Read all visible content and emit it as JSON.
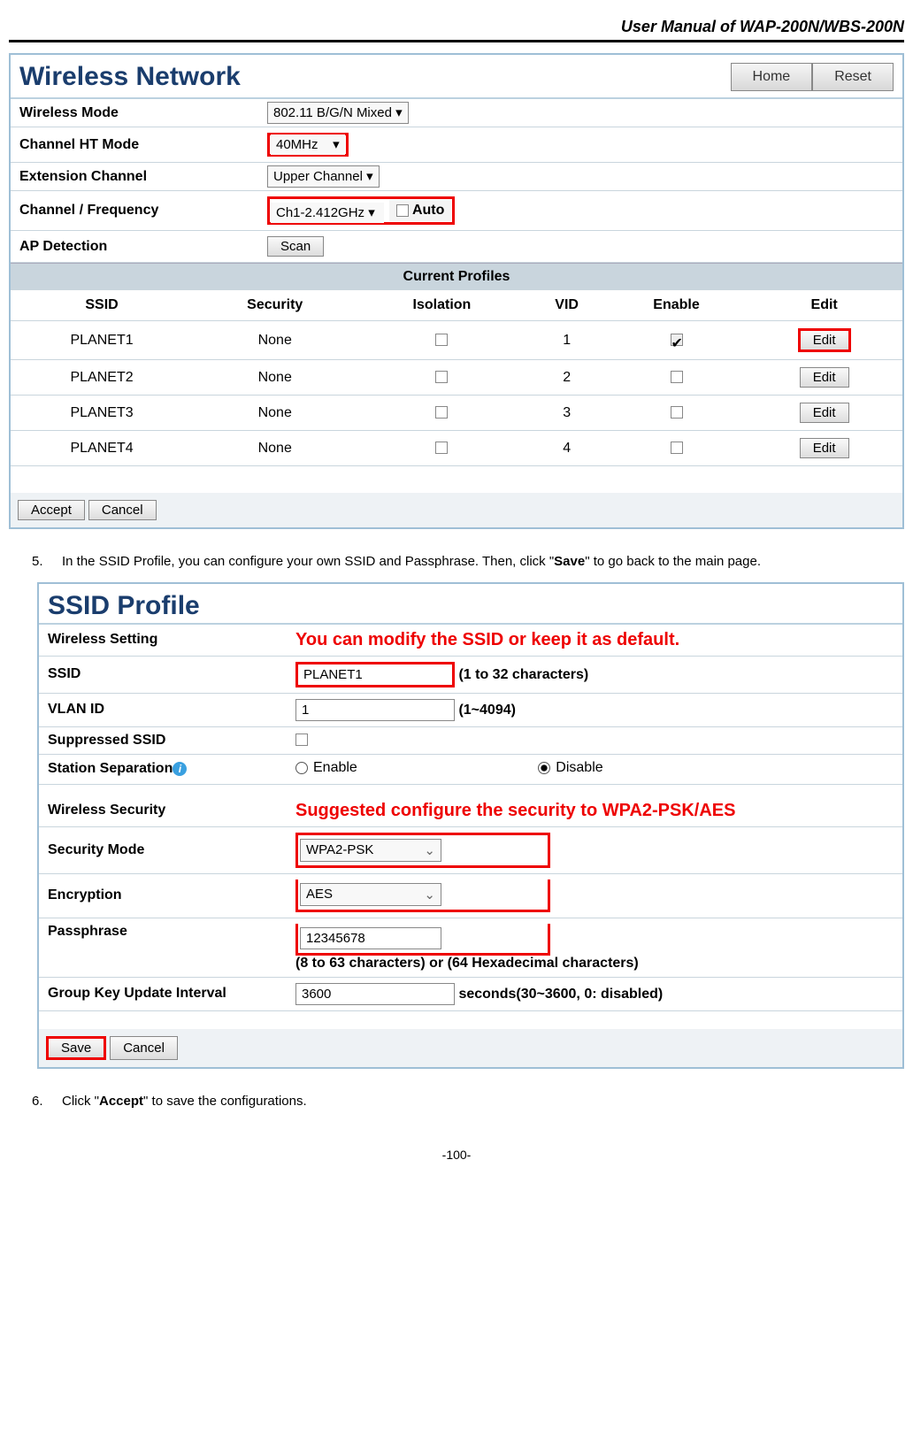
{
  "header": {
    "title": "User Manual of WAP-200N/WBS-200N"
  },
  "wireless": {
    "title": "Wireless Network",
    "homeBtn": "Home",
    "resetBtn": "Reset",
    "rows": {
      "wirelessMode": {
        "label": "Wireless Mode",
        "value": "802.11 B/G/N Mixed"
      },
      "channelHT": {
        "label": "Channel HT Mode",
        "value": "40MHz"
      },
      "extChannel": {
        "label": "Extension Channel",
        "value": "Upper Channel"
      },
      "channelFreq": {
        "label": "Channel / Frequency",
        "value": "Ch1-2.412GHz",
        "autoLabel": "Auto"
      },
      "apDetection": {
        "label": "AP Detection",
        "scanBtn": "Scan"
      }
    },
    "profilesTitle": "Current Profiles",
    "profilesCols": {
      "ssid": "SSID",
      "security": "Security",
      "isolation": "Isolation",
      "vid": "VID",
      "enable": "Enable",
      "edit": "Edit"
    },
    "profiles": [
      {
        "ssid": "PLANET1",
        "security": "None",
        "vid": "1",
        "enabled": true
      },
      {
        "ssid": "PLANET2",
        "security": "None",
        "vid": "2",
        "enabled": false
      },
      {
        "ssid": "PLANET3",
        "security": "None",
        "vid": "3",
        "enabled": false
      },
      {
        "ssid": "PLANET4",
        "security": "None",
        "vid": "4",
        "enabled": false
      }
    ],
    "editBtn": "Edit",
    "acceptBtn": "Accept",
    "cancelBtn": "Cancel"
  },
  "step5": {
    "num": "5.",
    "textA": "In the SSID Profile, you can configure your own SSID and Passphrase. Then, click \"",
    "bold": "Save",
    "textB": "\" to go back to the main page."
  },
  "ssidProfile": {
    "title": "SSID Profile",
    "sectionWireless": "Wireless Setting",
    "annot1": "You can modify the SSID or keep it as default.",
    "ssid": {
      "label": "SSID",
      "value": "PLANET1",
      "hint": "(1 to 32 characters)"
    },
    "vlan": {
      "label": "VLAN ID",
      "value": "1",
      "hint": "(1~4094)"
    },
    "suppressed": {
      "label": "Suppressed SSID"
    },
    "stationSep": {
      "label": "Station Separation",
      "enable": "Enable",
      "disable": "Disable"
    },
    "sectionSecurity": "Wireless Security",
    "annot2": "Suggested configure the security to WPA2-PSK/AES",
    "secMode": {
      "label": "Security Mode",
      "value": "WPA2-PSK"
    },
    "encryption": {
      "label": "Encryption",
      "value": "AES"
    },
    "passphrase": {
      "label": "Passphrase",
      "value": "12345678",
      "hint": "(8 to 63 characters) or (64 Hexadecimal characters)"
    },
    "groupKey": {
      "label": "Group Key Update Interval",
      "value": "3600",
      "hint": "seconds(30~3600, 0: disabled)"
    },
    "saveBtn": "Save",
    "cancelBtn": "Cancel"
  },
  "step6": {
    "num": "6.",
    "textA": "Click \"",
    "bold": "Accept",
    "textB": "\" to save the configurations."
  },
  "footer": "-100-"
}
